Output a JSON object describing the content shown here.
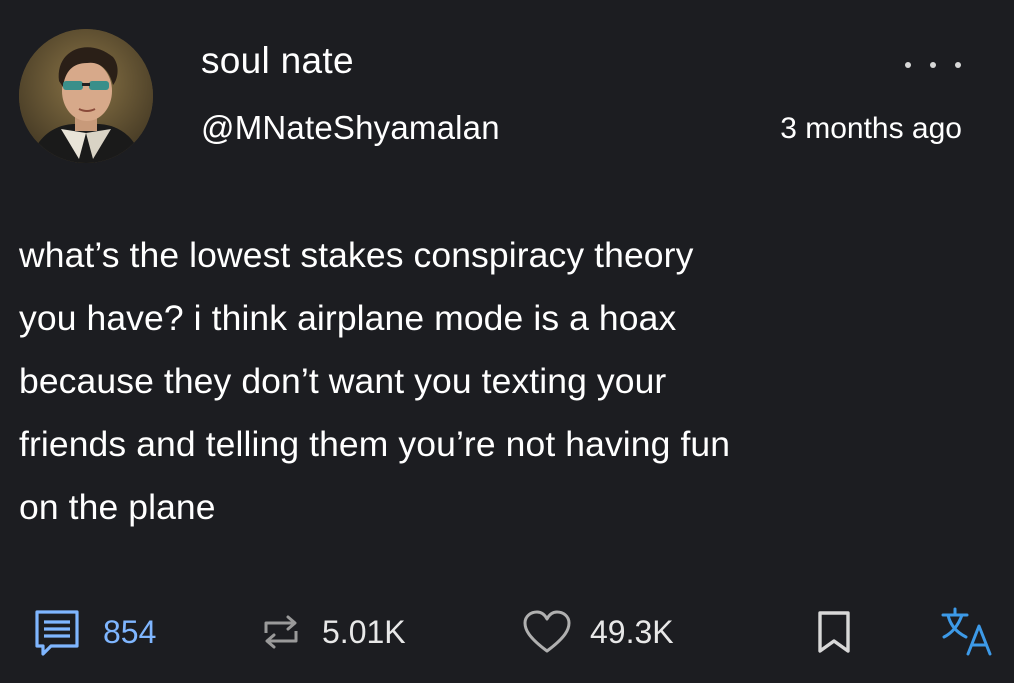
{
  "post": {
    "author": {
      "display_name": "soul nate",
      "handle": "@MNateShyamalan",
      "avatar_icon": "portrait-avatar"
    },
    "timestamp": "3 months ago",
    "text": "what’s the lowest stakes conspiracy theory you have? i think airplane mode is a hoax because they don’t want you texting your friends and telling them you’re not having fun on the plane",
    "lines": [
      "what’s the lowest stakes conspiracy theory",
      "you have? i think airplane mode is a hoax",
      "because they don’t want you texting your",
      "friends and telling them you’re not having fun",
      "on the plane"
    ]
  },
  "actions": {
    "comments": {
      "count": "854",
      "icon": "comment-icon",
      "color": "#7fb6ff"
    },
    "reposts": {
      "count": "5.01K",
      "icon": "repost-icon"
    },
    "likes": {
      "count": "49.3K",
      "icon": "heart-icon"
    },
    "bookmark": {
      "icon": "bookmark-icon"
    },
    "translate": {
      "icon": "translate-icon",
      "color": "#3d9ae8"
    }
  },
  "colors": {
    "background": "#1c1d21",
    "text": "#ffffff",
    "accent_blue": "#7fb6ff"
  }
}
